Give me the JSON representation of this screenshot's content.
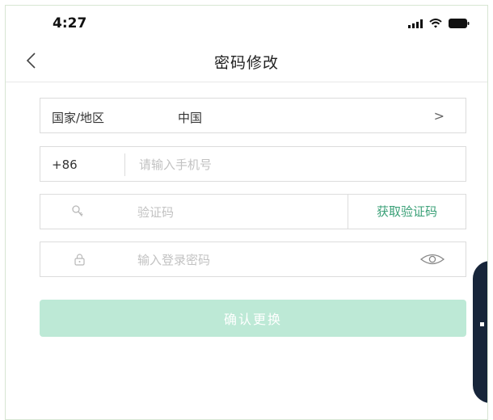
{
  "status_bar": {
    "time": "4:27",
    "icons": [
      "signal-icon",
      "wifi-icon",
      "battery-icon"
    ]
  },
  "nav": {
    "back_icon": "back-arrow-icon",
    "title": "密码修改"
  },
  "form": {
    "region": {
      "label": "国家/地区",
      "value": "中国",
      "arrow": ">"
    },
    "phone": {
      "country_code": "+86",
      "placeholder": "请输入手机号",
      "value": ""
    },
    "code": {
      "icon": "key-icon",
      "placeholder": "验证码",
      "value": "",
      "get_code_label": "获取验证码"
    },
    "password": {
      "icon": "lock-icon",
      "placeholder": "输入登录密码",
      "value": "",
      "toggle_icon": "eye-icon"
    },
    "confirm_label": "确认更换"
  },
  "colors": {
    "accent_green": "#3aa077",
    "button_disabled": "#bde9d6",
    "side_tab": "#17253a"
  }
}
